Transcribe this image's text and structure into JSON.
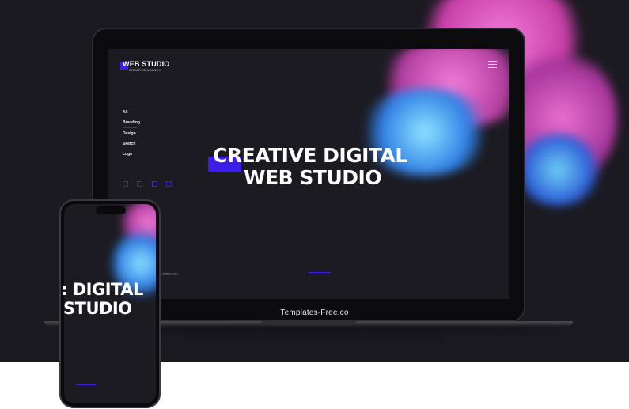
{
  "laptop": {
    "brand_text": "Templates-Free.co"
  },
  "site": {
    "logo_title": "WEB STUDIO",
    "logo_subtitle": "CREATIVE AGANCY",
    "nav": [
      "All",
      "Branding",
      "Design",
      "Sketch",
      "Logo"
    ],
    "active_nav": "Branding",
    "hero_line1": "CREATIVE DIGITAL",
    "hero_line2": "WEB STUDIO",
    "footer_link": "...plates.com",
    "socials": [
      "social-1",
      "social-2",
      "social-3",
      "social-4"
    ]
  },
  "phone": {
    "hero_line1": ": DIGITAL",
    "hero_line2": "STUDIO"
  },
  "colors": {
    "accent": "#3d1de8",
    "background": "#1c1b22",
    "ink_pink": "#e85bc5",
    "ink_blue": "#3a9ff0"
  }
}
